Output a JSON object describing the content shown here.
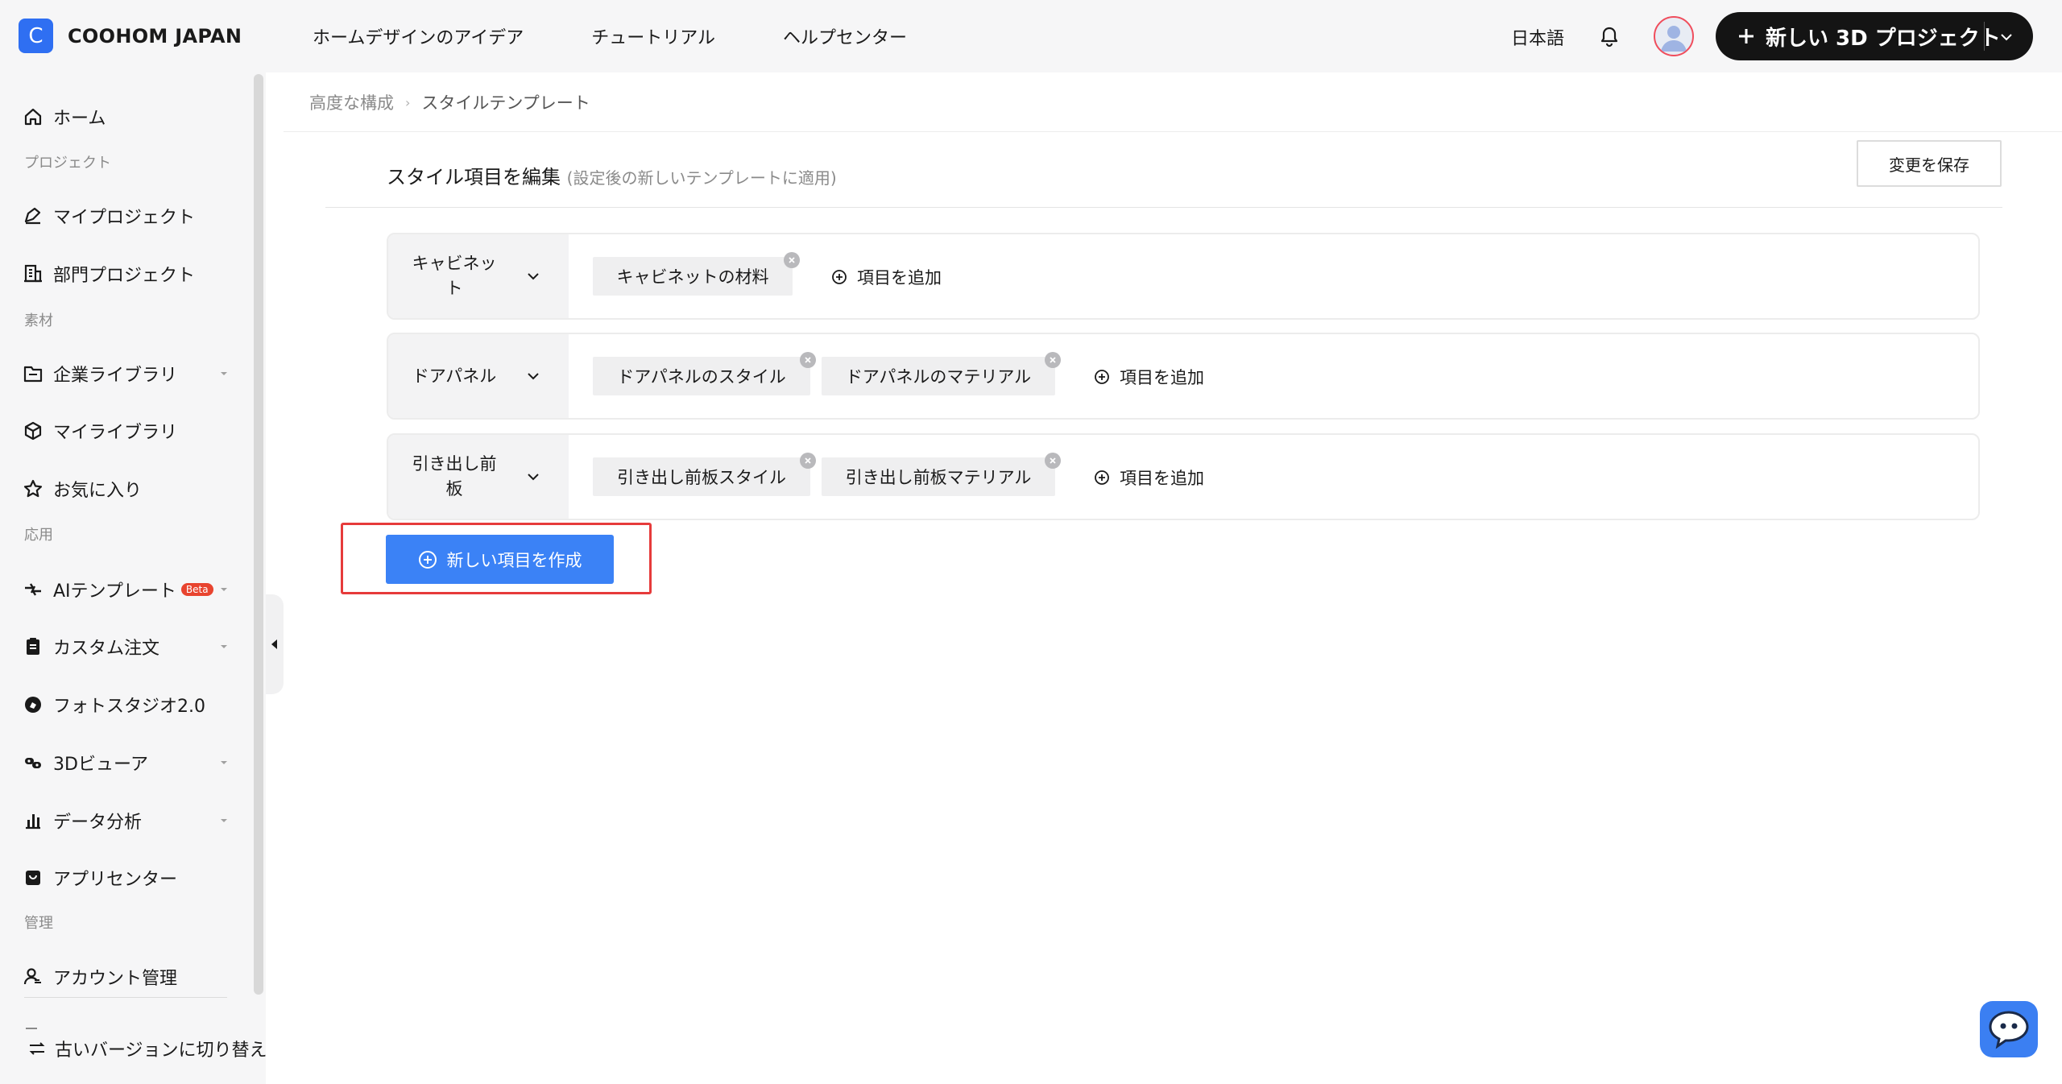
{
  "header": {
    "logo_letter": "C",
    "brand": "COOHOM JAPAN",
    "nav": [
      "ホームデザインのアイデア",
      "チュートリアル",
      "ヘルプセンター"
    ],
    "language": "日本語",
    "new_project_label": "新しい 3D プロジェクト"
  },
  "sidebar": {
    "home": "ホーム",
    "section_project": "プロジェクト",
    "my_projects": "マイプロジェクト",
    "dept_projects": "部門プロジェクト",
    "section_material": "素材",
    "company_library": "企業ライブラリ",
    "my_library": "マイライブラリ",
    "favorites": "お気に入り",
    "section_apps": "応用",
    "ai_templates": "AIテンプレート",
    "beta_badge": "Beta",
    "custom_order": "カスタム注文",
    "photo_studio": "フォトスタジオ2.0",
    "viewer_3d": "3Dビューア",
    "data_analysis": "データ分析",
    "app_center": "アプリセンター",
    "section_admin": "管理",
    "account_mgmt": "アカウント管理",
    "switch_old": "古いバージョンに切り替え"
  },
  "breadcrumb": {
    "parent": "高度な構成",
    "current": "スタイルテンプレート"
  },
  "editor": {
    "title": "スタイル項目を編集",
    "note": "(設定後の新しいテンプレートに適用)",
    "save_button": "変更を保存",
    "add_item_label": "項目を追加",
    "create_button": "新しい項目を作成",
    "rows": [
      {
        "name": "キャビネット",
        "items": [
          "キャビネットの材料"
        ]
      },
      {
        "name": "ドアパネル",
        "items": [
          "ドアパネルのスタイル",
          "ドアパネルのマテリアル"
        ]
      },
      {
        "name": "引き出し前板",
        "items": [
          "引き出し前板スタイル",
          "引き出し前板マテリアル"
        ]
      }
    ]
  },
  "colors": {
    "brand_blue": "#2f6ff2",
    "primary_button": "#3b82f6",
    "highlight_border": "#e63b3b",
    "dark_button": "#141414"
  }
}
